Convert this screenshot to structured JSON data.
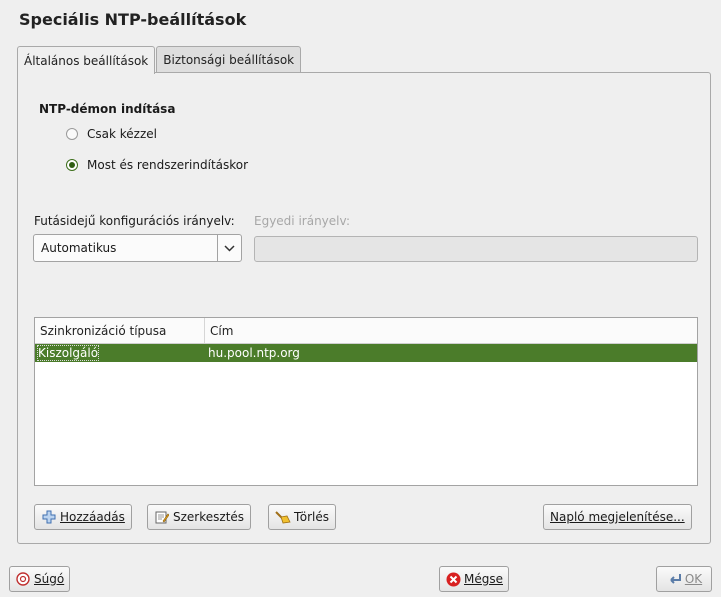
{
  "window": {
    "title": "Speciális NTP-beállítások"
  },
  "tabs": [
    {
      "label": "Általános beállítások",
      "active": true
    },
    {
      "label": "Biztonsági beállítások",
      "active": false
    }
  ],
  "start": {
    "heading": "NTP-démon indítása",
    "options": [
      {
        "label": "Csak kézzel",
        "checked": false
      },
      {
        "label": "Most és rendszerindításkor",
        "checked": true
      }
    ]
  },
  "policy": {
    "label": "Futásidejű konfigurációs irányelv:",
    "value": "Automatikus",
    "custom_label": "Egyedi irányelv:",
    "custom_value": ""
  },
  "servers": {
    "columns": [
      "Szinkronizáció típusa",
      "Cím"
    ],
    "rows": [
      {
        "type": "Kiszolgáló",
        "address": "hu.pool.ntp.org",
        "selected": true
      }
    ]
  },
  "actions": {
    "add": "Hozzáadás",
    "edit": "Szerkesztés",
    "delete": "Törlés",
    "log": "Napló megjelenítése..."
  },
  "footer": {
    "help": "Súgó",
    "cancel": "Mégse",
    "ok": "OK"
  },
  "colors": {
    "selection": "#4b7c2a",
    "radio_checked": "#2f5e12"
  },
  "icons": {
    "add": "plus-icon",
    "edit": "edit-icon",
    "delete": "broom-icon",
    "help": "help-icon",
    "cancel": "cancel-icon",
    "ok": "ok-arrow-icon"
  }
}
